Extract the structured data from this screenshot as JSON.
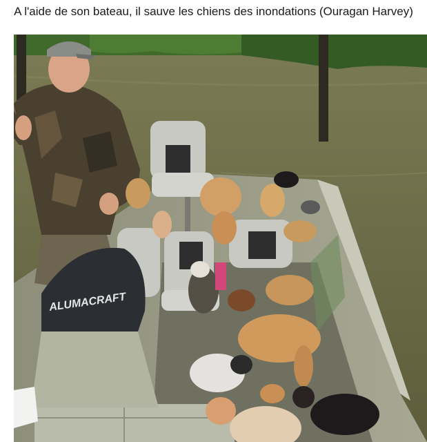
{
  "caption": {
    "text": "A l'aide de son bateau, il sauve les chiens des inondations (Ouragan Harvey)"
  },
  "photo": {
    "boat_brand_text": "ALUMACRAFT",
    "colors": {
      "water": "#6b6a44",
      "treeline": "#3f6a2c",
      "boat_hull": "#9a9c86",
      "seat": "#c9c9c4",
      "camo_shirt": "#4a4030",
      "cap": "#8a8c88",
      "motor": "#2b2e33",
      "dog_tan": "#c99a5e",
      "dog_black": "#1c1a1a"
    }
  }
}
